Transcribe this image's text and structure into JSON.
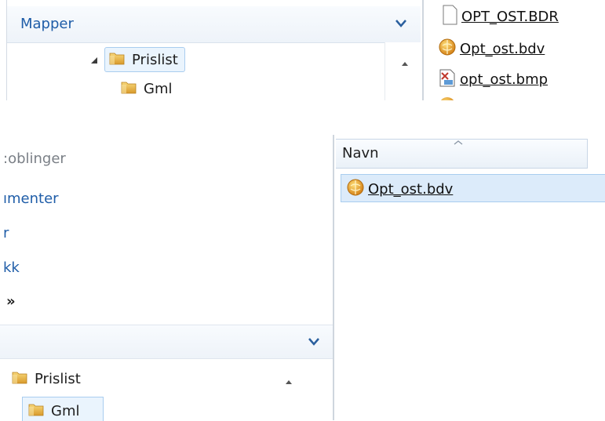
{
  "top_pane": {
    "folders_header": {
      "label": "Mapper"
    },
    "tree": [
      {
        "label": "Prislist",
        "selected": true,
        "expanded": true,
        "icon": "folder-icon"
      },
      {
        "label": "Gml",
        "selected": false,
        "icon": "folder-icon"
      }
    ],
    "files": [
      {
        "name": "OPT_OST.BDR",
        "icon": "blank-file-icon"
      },
      {
        "name": "Opt_ost.bdv",
        "icon": "globe-file-icon"
      },
      {
        "name": "opt_ost.bmp",
        "icon": "image-file-icon"
      }
    ]
  },
  "bottom_pane": {
    "nav_items": [
      {
        "label": ":oblinger",
        "muted": true
      },
      {
        "label": "ımenter"
      },
      {
        "label": "r"
      },
      {
        "label": "kk"
      },
      {
        "label": "»"
      }
    ],
    "tree": [
      {
        "label": "Prislist",
        "icon": "folder-icon"
      },
      {
        "label": "Gml",
        "selected": true,
        "icon": "folder-icon"
      }
    ],
    "column_header": "Navn",
    "files": [
      {
        "name": "Opt_ost.bdv",
        "selected": true,
        "icon": "globe-file-icon"
      }
    ]
  },
  "colors": {
    "link_blue": "#1f5da8",
    "selection_fill": "#dcebfa",
    "selection_border": "#a9cdef",
    "folder_yellow": "#e9b84a",
    "globe_orange": "#e39a1c"
  }
}
